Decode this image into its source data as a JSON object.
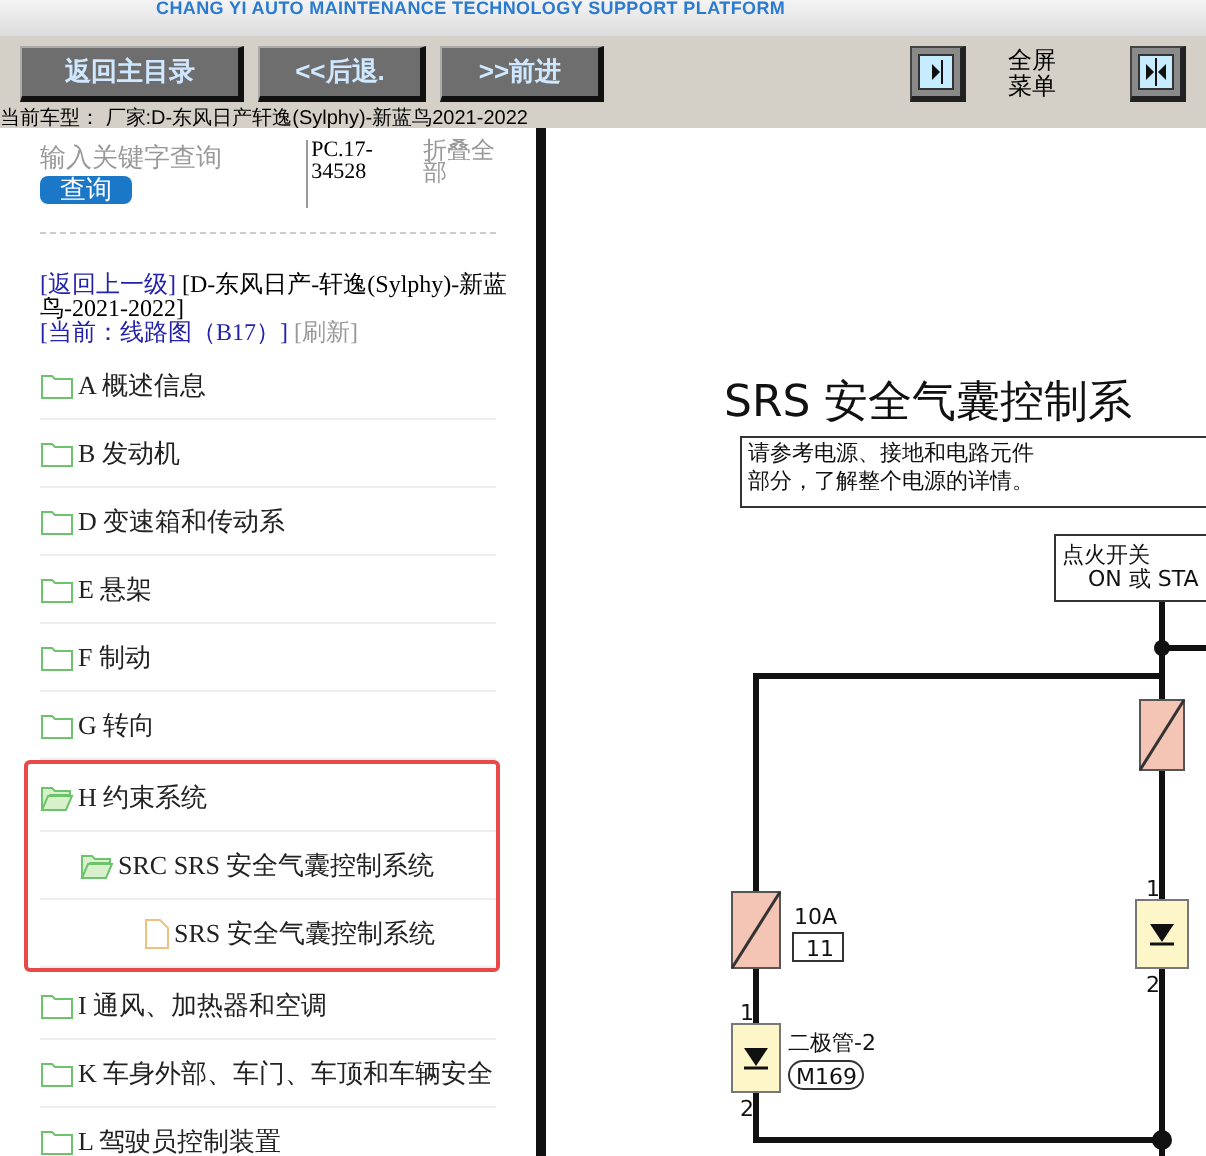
{
  "banner": {
    "subtitle": "CHANG YI AUTO MAINTENANCE TECHNOLOGY SUPPORT PLATFORM"
  },
  "toolbar": {
    "buttons": [
      "返回主目录",
      "<<后退.",
      ">>前进"
    ],
    "fullscreen_label": "全屏菜单"
  },
  "vehicle_line": "当前车型：  厂家:D-东风日产轩逸(Sylphy)-新蓝鸟2021-2022",
  "sidebar": {
    "search": {
      "placeholder": "输入关键字查询",
      "button": "查询"
    },
    "code": "PC.17-34528",
    "collapse_all": "折叠全部",
    "breadcrumb": {
      "back": "[返回上一级]",
      "path": "[D-东风日产-轩逸(Sylphy)-新蓝鸟-2021-2022]",
      "current": "[当前：线路图（B17）]",
      "refresh": "[刷新]"
    },
    "tree": [
      {
        "label": "A 概述信息",
        "kind": "folder",
        "expanded": false,
        "highlighted": false
      },
      {
        "label": "B 发动机",
        "kind": "folder",
        "expanded": false,
        "highlighted": false
      },
      {
        "label": "D 变速箱和传动系",
        "kind": "folder",
        "expanded": false,
        "highlighted": false
      },
      {
        "label": "E 悬架",
        "kind": "folder",
        "expanded": false,
        "highlighted": false
      },
      {
        "label": "F 制动",
        "kind": "folder",
        "expanded": false,
        "highlighted": false
      },
      {
        "label": "G 转向",
        "kind": "folder",
        "expanded": false,
        "highlighted": false
      },
      {
        "label": "H 约束系统",
        "kind": "folder",
        "expanded": true,
        "highlighted": true,
        "children": [
          {
            "label": "SRC SRS 安全气囊控制系统",
            "kind": "folder",
            "expanded": true,
            "children": [
              {
                "label": "SRS 安全气囊控制系统",
                "kind": "file"
              }
            ]
          }
        ]
      },
      {
        "label": "I 通风、加热器和空调",
        "kind": "folder",
        "expanded": false,
        "highlighted": false
      },
      {
        "label": "K 车身外部、车门、车顶和车辆安全",
        "kind": "folder",
        "expanded": false,
        "highlighted": false
      },
      {
        "label": "L 驾驶员控制装置",
        "kind": "folder",
        "expanded": false,
        "highlighted": false
      }
    ]
  },
  "diagram": {
    "title": "SRS 安全气囊控制系",
    "note": [
      "请参考电源、接地和电路元件",
      "部分，了解整个电源的详情。"
    ],
    "switch": {
      "label": "点火开关",
      "position": "ON 或 STA"
    },
    "fuse": {
      "rating": "10A",
      "number": "11"
    },
    "diode": {
      "name": "二极管-2",
      "connector": "M169",
      "pin_in": "1",
      "pin_out": "2"
    },
    "right_diode": {
      "pin_in": "1",
      "pin_out": "2"
    }
  }
}
